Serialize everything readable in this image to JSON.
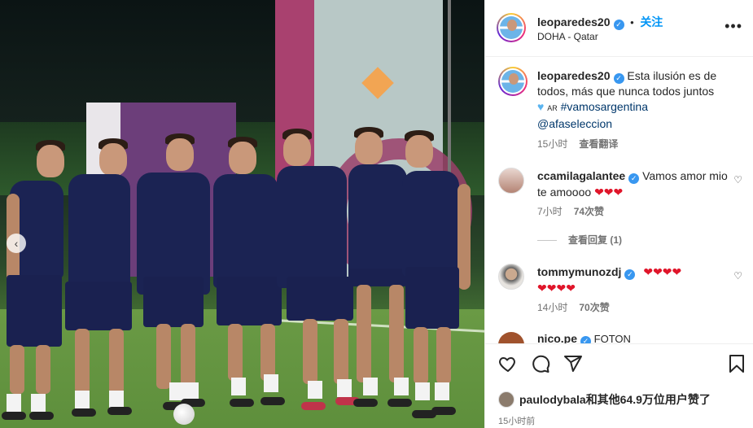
{
  "header": {
    "username": "leoparedes20",
    "separator": "•",
    "follow_label": "关注",
    "location": "DOHA - Qatar",
    "more_label": "•••"
  },
  "caption": {
    "username": "leoparedes20",
    "text": "Esta ilusión es de todos, más que nunca todos juntos",
    "flag_text": "AR",
    "hashtag": "#vamosargentina",
    "mention": "@afaseleccion",
    "time": "15小时",
    "translate": "查看翻译"
  },
  "comments": [
    {
      "username": "ccamilagalantee",
      "text": "Vamos amor mio te amoooo",
      "hearts": "❤❤❤",
      "time": "7小时",
      "likes": "74次赞"
    },
    {
      "username": "tommymunozdj",
      "text": "",
      "hearts": "❤❤❤❤",
      "hearts2": "❤❤❤❤",
      "time": "14小时",
      "likes": "70次赞"
    }
  ],
  "partial_comment": {
    "username": "nico.pe",
    "text": "FOTON"
  },
  "replies": {
    "label": "查看回复 (1)"
  },
  "likes": {
    "user": "paulodybala",
    "rest": "和其他64.9万位用户赞了"
  },
  "post_time": "15小时前",
  "colors": {
    "accent": "#0095f6",
    "verified": "#3897f0",
    "heart": "#e0152a",
    "hashtag": "#00376b"
  },
  "icons": [
    "heart-icon",
    "comment-icon",
    "share-icon",
    "bookmark-icon",
    "verified-icon",
    "more-icon",
    "chevron-left-icon"
  ]
}
